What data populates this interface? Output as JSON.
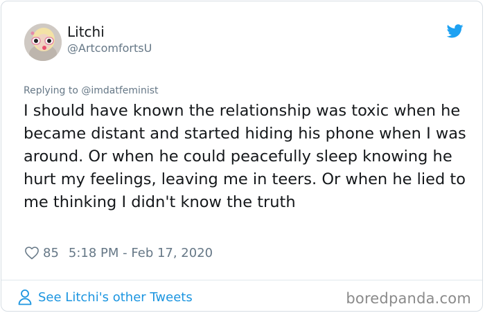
{
  "author": {
    "display_name": "Litchi",
    "handle": "@ArtcomfortsU"
  },
  "tweet": {
    "replying_prefix": "Replying to",
    "replying_handle": "@imdatfeminist",
    "text": "I should have known the relationship was toxic when he became distant and started hiding his phone when I was around. Or when he could peacefully sleep knowing he hurt my feelings, leaving me in teers. Or when he lied to me thinking I didn't know the truth",
    "like_count": "85",
    "timestamp": "5:18 PM - Feb 17, 2020"
  },
  "footer": {
    "see_more_label": "See Litchi's other Tweets",
    "watermark": "boredpanda.com"
  },
  "icons": {
    "brand": "twitter-bird-icon",
    "like": "heart-outline-icon",
    "profile": "person-outline-icon"
  },
  "colors": {
    "twitter_blue": "#1da1f2",
    "link_blue": "#1b95e0",
    "secondary_text": "#657786",
    "primary_text": "#14171a"
  }
}
